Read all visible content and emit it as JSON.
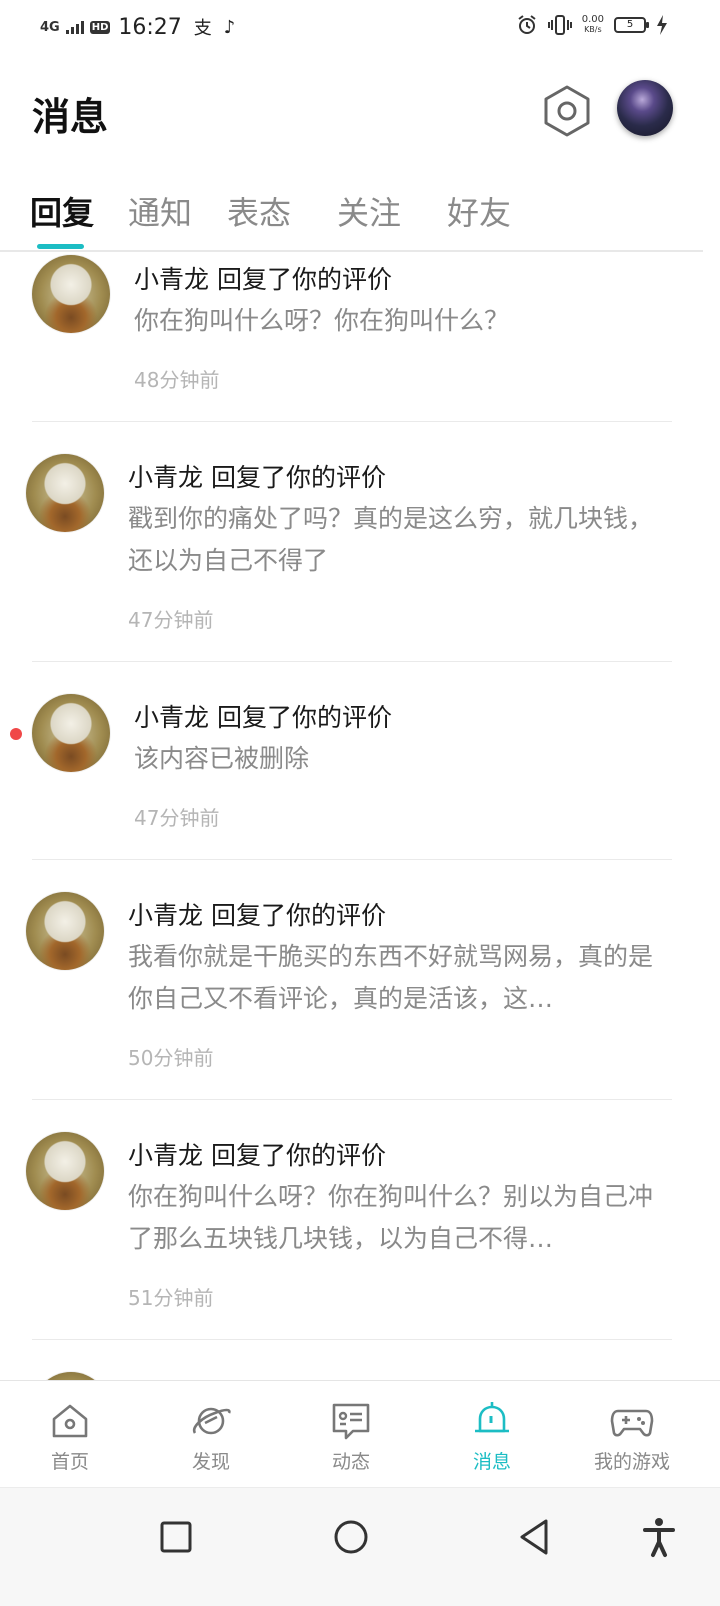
{
  "status_bar": {
    "network": "4G",
    "hd": "HD",
    "time": "16:27",
    "app_icons": [
      "支",
      "♪"
    ],
    "speed_value": "0.00",
    "speed_unit": "KB/s",
    "battery": "5"
  },
  "header": {
    "title": "消息"
  },
  "tabs": [
    {
      "label": "回复",
      "active": true
    },
    {
      "label": "通知",
      "active": false
    },
    {
      "label": "表态",
      "active": false
    },
    {
      "label": "关注",
      "active": false
    },
    {
      "label": "好友",
      "active": false
    }
  ],
  "messages": [
    {
      "title": "小青龙 回复了你的评价",
      "body": "你在狗叫什么呀？你在狗叫什么？",
      "time": "48分钟前",
      "unread": false
    },
    {
      "title": "小青龙 回复了你的评价",
      "body": "戳到你的痛处了吗？真的是这么穷，就几块钱，还以为自己不得了",
      "time": "47分钟前",
      "unread": false
    },
    {
      "title": "小青龙 回复了你的评价",
      "body": "该内容已被删除",
      "time": "47分钟前",
      "unread": true
    },
    {
      "title": "小青龙 回复了你的评价",
      "body": "我看你就是干脆买的东西不好就骂网易，真的是你自己又不看评论，真的是活该，这…",
      "time": "50分钟前",
      "unread": false
    },
    {
      "title": "小青龙 回复了你的评价",
      "body": "你在狗叫什么呀？你在狗叫什么？别以为自己冲了那么五块钱几块钱，以为自己不得…",
      "time": "51分钟前",
      "unread": false
    }
  ],
  "bottom_nav": [
    {
      "label": "首页",
      "icon": "home-icon",
      "active": false
    },
    {
      "label": "发现",
      "icon": "planet-icon",
      "active": false
    },
    {
      "label": "动态",
      "icon": "chat-card-icon",
      "active": false
    },
    {
      "label": "消息",
      "icon": "bell-icon",
      "active": true
    },
    {
      "label": "我的游戏",
      "icon": "gamepad-icon",
      "active": false
    }
  ],
  "colors": {
    "accent": "#1cbdc4",
    "unread_dot": "#f04848"
  }
}
